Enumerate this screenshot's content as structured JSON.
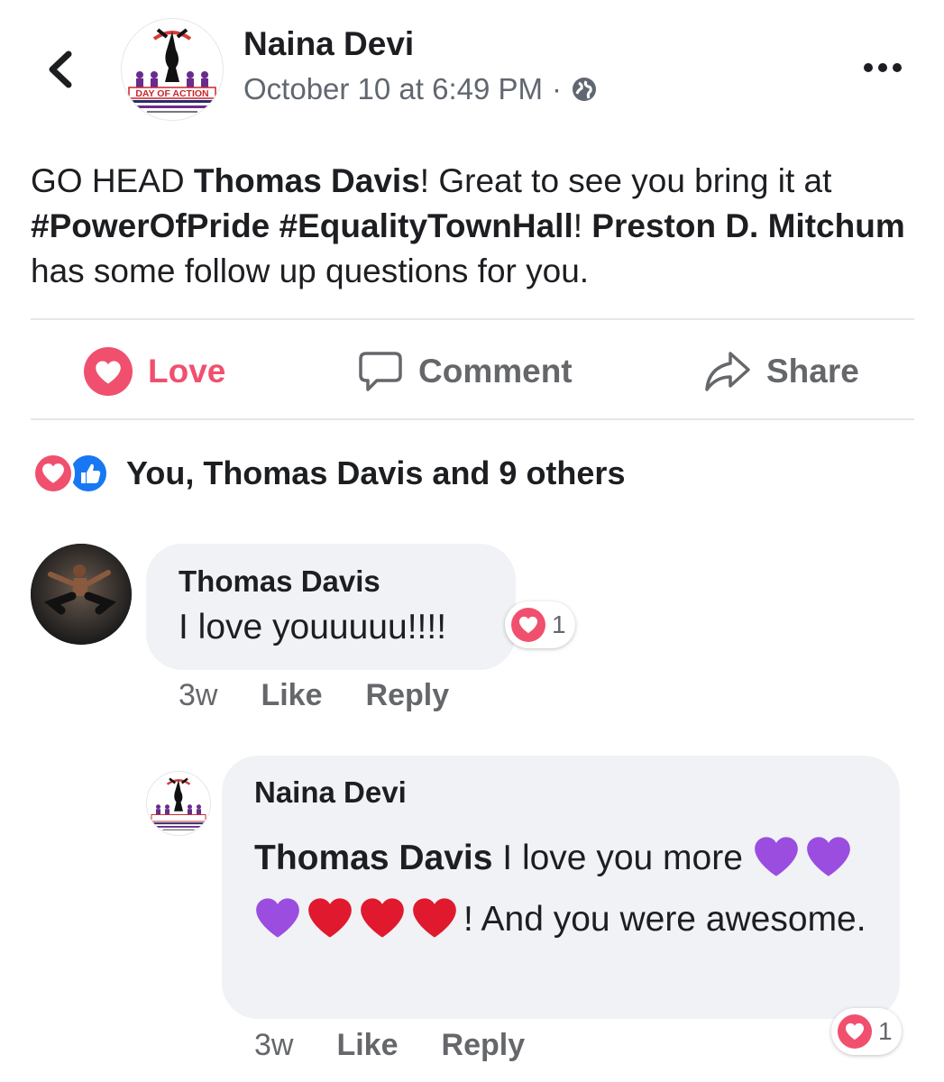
{
  "header": {
    "author": "Naina Devi",
    "timestamp": "October 10 at 6:49 PM",
    "separator": "·",
    "privacy_icon": "globe-icon",
    "logo_text": "DAY OF ACTION"
  },
  "post": {
    "segments": [
      {
        "text": "GO HEAD ",
        "bold": false
      },
      {
        "text": "Thomas Davis",
        "bold": true
      },
      {
        "text": "!  Great to see you bring it at ",
        "bold": false
      },
      {
        "text": "#PowerOfPride #EqualityTownHall",
        "bold": true
      },
      {
        "text": "!  ",
        "bold": false
      },
      {
        "text": "Preston D. Mitchum",
        "bold": true
      },
      {
        "text": " has some follow up questions for you.",
        "bold": false
      }
    ]
  },
  "actions": {
    "love_label": "Love",
    "comment_label": "Comment",
    "share_label": "Share"
  },
  "reactions": {
    "summary": "You, Thomas Davis and 9 others"
  },
  "comments": [
    {
      "author": "Thomas Davis",
      "text": "I love youuuuu!!!!",
      "reaction_count": "1",
      "age": "3w",
      "like_label": "Like",
      "reply_label": "Reply"
    },
    {
      "author": "Naina Devi",
      "mention": "Thomas Davis",
      "text_before_emoji": " I love you more ",
      "emojis": [
        "purple-heart",
        "purple-heart",
        "purple-heart",
        "red-heart",
        "red-heart",
        "red-heart"
      ],
      "text_after_emoji": "! And you were awesome.",
      "reaction_count": "1",
      "age": "3w",
      "like_label": "Like",
      "reply_label": "Reply"
    }
  ],
  "colors": {
    "love": "#f0506e",
    "like_blue": "#1877f2",
    "muted": "#65676b",
    "bubble": "#f0f2f5",
    "purple_heart": "#9b4de0",
    "red_heart": "#e0192e"
  }
}
